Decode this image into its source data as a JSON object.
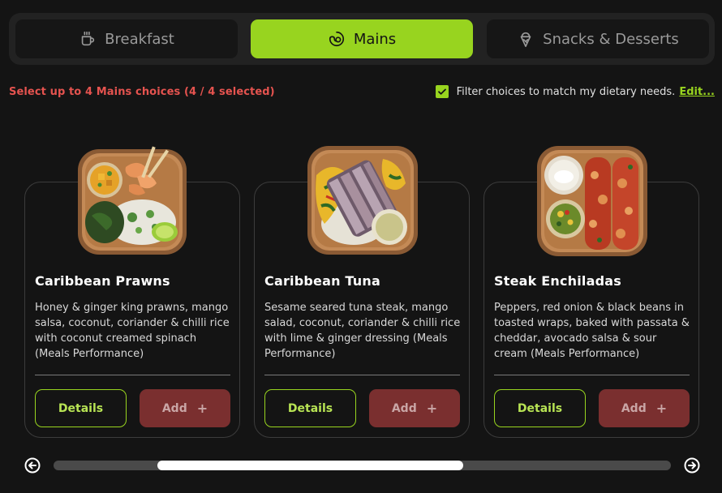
{
  "tabs": [
    {
      "label": "Breakfast",
      "icon": "coffee-cup-icon",
      "active": false
    },
    {
      "label": "Mains",
      "icon": "food-bowl-icon",
      "active": true
    },
    {
      "label": "Snacks & Desserts",
      "icon": "ice-cream-icon",
      "active": false
    }
  ],
  "selection_message": "Select up to 4 Mains choices (4 / 4 selected)",
  "filter": {
    "label": "Filter choices to match my dietary needs.",
    "edit_link": "Edit...",
    "checked": true
  },
  "meals": [
    {
      "title": "Caribbean Prawns",
      "description": "Honey & ginger king prawns, mango salsa, coconut, coriander & chilli rice with coconut creamed spinach (Meals Performance)",
      "details_label": "Details",
      "add_label": "Add",
      "add_icon": "+"
    },
    {
      "title": "Caribbean Tuna",
      "description": "Sesame seared tuna steak, mango salad, coconut, coriander & chilli rice with lime & ginger dressing (Meals Performance)",
      "details_label": "Details",
      "add_label": "Add",
      "add_icon": "+"
    },
    {
      "title": "Steak Enchiladas",
      "description": "Peppers, red onion & black beans in toasted wraps, baked with passata & cheddar, avocado salsa & sour cream (Meals Performance)",
      "details_label": "Details",
      "add_label": "Add",
      "add_icon": "+"
    }
  ],
  "carousel": {
    "prev_icon": "arrow-left-circle-icon",
    "next_icon": "arrow-right-circle-icon"
  },
  "colors": {
    "accent": "#98d41f",
    "warning": "#e5534f",
    "add_button": "#7a2f2f",
    "background": "#141414"
  }
}
